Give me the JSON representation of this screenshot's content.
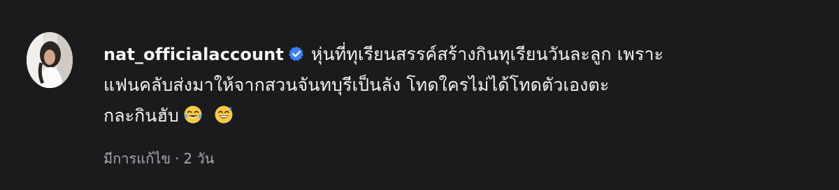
{
  "comment": {
    "username": "nat_officialaccount",
    "verified": true,
    "text_lines": [
      "หุ่นที่ทุเรียนสรรค์สร้างกินทุเรียนวันละลูก เพราะ",
      "แฟนคลับส่งมาให้จากสวนจันทบุรีเป็นลัง โทดใครไม่ได้โทดตัวเองตะ",
      "กละกินฮับ"
    ],
    "emojis": [
      "face-with-tears-of-joy-icon",
      "grinning-face-with-sweat-icon"
    ],
    "edited_label": "มีการแก้ไข",
    "separator": "·",
    "time": "2 วัน"
  },
  "colors": {
    "background": "#1b1b1e",
    "text": "#f2f2f4",
    "meta": "#a8a8ad",
    "verified_badge": "#3b82f6"
  }
}
